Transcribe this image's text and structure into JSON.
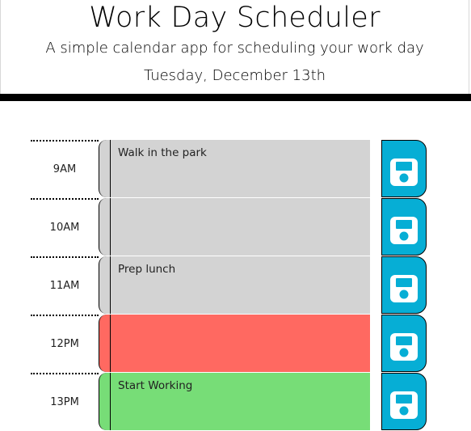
{
  "header": {
    "title": "Work Day Scheduler",
    "lead": "A simple calendar app for scheduling your work day",
    "current_day": "Tuesday, December 13th"
  },
  "colors": {
    "past": "#d3d3d3",
    "present": "#ff6961",
    "future": "#77dd77",
    "save": "#06aed5"
  },
  "time_blocks": [
    {
      "hour": "9AM",
      "text": "Walk in the park",
      "state": "past",
      "save_icon": "floppy-disk-icon"
    },
    {
      "hour": "10AM",
      "text": "",
      "state": "past",
      "save_icon": "floppy-disk-icon"
    },
    {
      "hour": "11AM",
      "text": "Prep lunch",
      "state": "past",
      "save_icon": "floppy-disk-icon"
    },
    {
      "hour": "12PM",
      "text": "",
      "state": "present",
      "save_icon": "floppy-disk-icon"
    },
    {
      "hour": "13PM",
      "text": "Start Working",
      "state": "future",
      "save_icon": "floppy-disk-icon"
    }
  ]
}
